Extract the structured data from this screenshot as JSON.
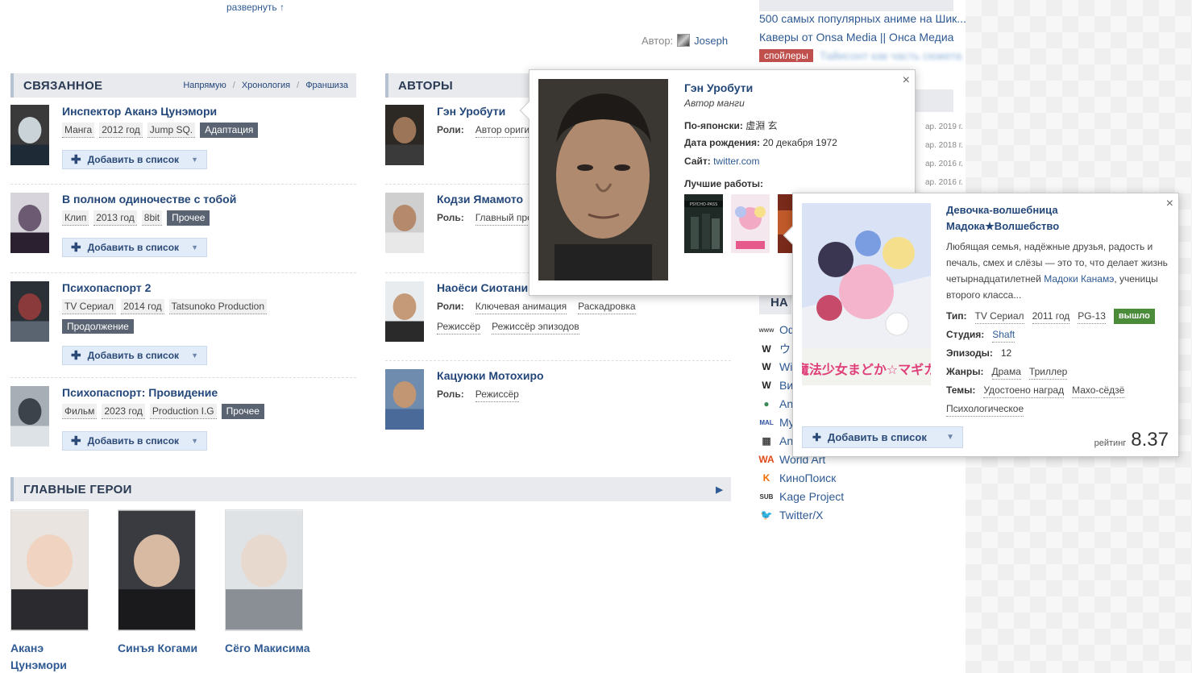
{
  "top": {
    "expand": "развернуть ↑",
    "author_label": "Автор:",
    "author_name": "Joseph"
  },
  "related": {
    "title": "СВЯЗАННОЕ",
    "links": [
      "Напрямую",
      "Хронология",
      "Франшиза"
    ],
    "add_label": "Добавить в список",
    "items": [
      {
        "title": "Инспектор Аканэ Цунэмори",
        "tags": [
          "Манга",
          "2012 год",
          "Jump SQ."
        ],
        "badge": "Адаптация",
        "colors": [
          "#3a3a3a",
          "#c9d3d8",
          "#1e2a36"
        ]
      },
      {
        "title": "В полном одиночестве с тобой",
        "tags": [
          "Клип",
          "2013 год",
          "8bit"
        ],
        "badge": "Прочее",
        "colors": [
          "#d8d4dc",
          "#6b5a72",
          "#2a2030"
        ]
      },
      {
        "title": "Психопаспорт 2",
        "tags": [
          "TV Сериал",
          "2014 год",
          "Tatsunoko Production"
        ],
        "badge": "Продолжение",
        "colors": [
          "#2b2f36",
          "#8a3a3a",
          "#596470"
        ]
      },
      {
        "title": "Психопаспорт: Провидение",
        "tags": [
          "Фильм",
          "2023 год",
          "Production I.G"
        ],
        "badge": "Прочее",
        "colors": [
          "#a7aeb5",
          "#3c434b",
          "#dde2e6"
        ]
      }
    ]
  },
  "authors": {
    "title": "АВТОРЫ",
    "roles_label_one": "Роли:",
    "roles_label": "Роль:",
    "items": [
      {
        "name": "Гэн Уробути",
        "label": "Роли:",
        "roles": [
          "Автор оригин"
        ]
      },
      {
        "name": "Кодзи Ямамото",
        "label": "Роль:",
        "roles": [
          "Главный прод"
        ]
      },
      {
        "name": "Наоёси Сиотани",
        "label": "Роли:",
        "roles": [
          "Ключевая анимация",
          "Раскадровка",
          "Режиссёр",
          "Режиссёр эпизодов"
        ]
      },
      {
        "name": "Кацуюки Мотохиро",
        "label": "Роль:",
        "roles": [
          "Режиссёр"
        ]
      }
    ]
  },
  "heroes": {
    "title": "ГЛАВНЫЕ ГЕРОИ",
    "items": [
      {
        "name": "Аканэ Цунэмори"
      },
      {
        "name": "Синъя Когами"
      },
      {
        "name": "Сёго Макисима"
      }
    ]
  },
  "right": {
    "links": [
      "500 самых популярных аниме на Шик...",
      "Каверы от Onsa Media || Онса Медиа"
    ],
    "spoiler": "спойлеры",
    "blurred": "Тайисонт как часть сюжета",
    "dates": [
      "ар. 2019 г.",
      "ар. 2018 г.",
      "ар. 2016 г.",
      "ар. 2016 г."
    ],
    "na_title": "НА",
    "external": [
      {
        "icon": "www",
        "label": "Оф"
      },
      {
        "icon": "W",
        "label": "ウ"
      },
      {
        "icon": "W",
        "label": "Wi"
      },
      {
        "icon": "W",
        "label": "Ви"
      },
      {
        "icon": "●",
        "label": "An"
      },
      {
        "icon": "MAL",
        "label": "My"
      },
      {
        "icon": "▦",
        "label": "An"
      },
      {
        "icon": "WA",
        "label": "World Art"
      },
      {
        "icon": "K",
        "label": "КиноПоиск"
      },
      {
        "icon": "SUB",
        "label": "Kage Project"
      },
      {
        "icon": "🐦",
        "label": "Twitter/X"
      }
    ]
  },
  "person_popup": {
    "name": "Гэн Уробути",
    "role": "Автор манги",
    "japanese_label": "По-японски:",
    "japanese_value": "虚淵 玄",
    "birth_label": "Дата рождения:",
    "birth_value": "20 декабря 1972",
    "site_label": "Сайт:",
    "site_value": "twitter.com",
    "best_label": "Лучшие работы:",
    "close": "×"
  },
  "anime_popup": {
    "title": "Девочка-волшебница Мадока★Волшебство",
    "desc_before": "Любящая семья, надёжные друзья, радость и печаль, смех и слёзы — это то, что делает жизнь четырнадцатилетней ",
    "desc_link": "Мадоки Канамэ",
    "desc_after": ", ученицы второго класса...",
    "type_label": "Тип:",
    "type_values": [
      "TV Сериал",
      "2011 год",
      "PG-13"
    ],
    "status": "вышло",
    "studio_label": "Студия:",
    "studio": "Shaft",
    "episodes_label": "Эпизоды:",
    "episodes": "12",
    "genres_label": "Жанры:",
    "genres": [
      "Драма",
      "Триллер"
    ],
    "themes_label": "Темы:",
    "themes": [
      "Удостоено наград",
      "Махо-сёдзё",
      "Психологическое"
    ],
    "add_label": "Добавить в список",
    "rating_label": "рейтинг",
    "rating": "8.37",
    "poster_text": "魔法少女まどか☆マギカ",
    "close": "×"
  }
}
